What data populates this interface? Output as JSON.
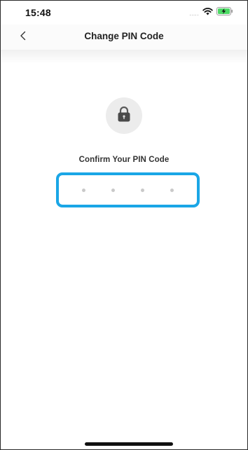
{
  "status_bar": {
    "time": "15:48",
    "signal_text": ".....",
    "icons": [
      "wifi-icon",
      "battery-charging-icon"
    ],
    "battery_color": "#4cd964"
  },
  "nav": {
    "back_icon": "chevron-left-icon",
    "title": "Change PIN Code"
  },
  "lock": {
    "icon": "lock-icon"
  },
  "pin": {
    "prompt": "Confirm Your PIN Code",
    "digit_count": 4,
    "filled_count": 0,
    "highlight_color": "#1aa6e6"
  }
}
